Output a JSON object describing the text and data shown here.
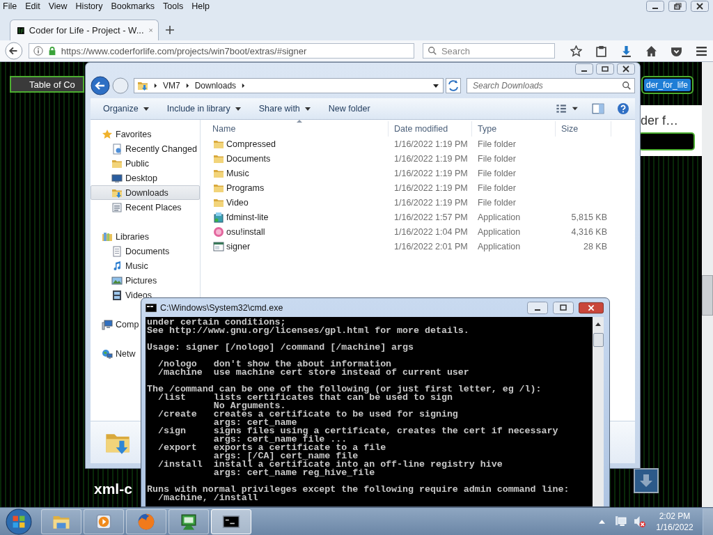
{
  "browser": {
    "menu": [
      "File",
      "Edit",
      "View",
      "History",
      "Bookmarks",
      "Tools",
      "Help"
    ],
    "tab": {
      "title": "Coder for Life - Project - W..."
    },
    "url": "https://www.coderforlife.com/projects/win7boot/extras/#signer",
    "search": {
      "placeholder": "Search"
    }
  },
  "page": {
    "toc_button": "Table of Co",
    "user_button": "der_for_life",
    "heading": "der f…",
    "footer_heading": "xml-c"
  },
  "explorer": {
    "breadcrumb": [
      "VM7",
      "Downloads"
    ],
    "search": {
      "placeholder": "Search Downloads"
    },
    "toolbar": [
      {
        "label": "Organize",
        "dropdown": true
      },
      {
        "label": "Include in library",
        "dropdown": true
      },
      {
        "label": "Share with",
        "dropdown": true
      },
      {
        "label": "New folder",
        "dropdown": false
      }
    ],
    "nav": [
      {
        "label": "Favorites",
        "kind": "star",
        "selected": false,
        "children": [
          {
            "label": "Recently Changed",
            "kind": "history",
            "selected": false
          },
          {
            "label": "Public",
            "kind": "folder",
            "selected": false
          },
          {
            "label": "Desktop",
            "kind": "desktop",
            "selected": false
          },
          {
            "label": "Downloads",
            "kind": "downloads",
            "selected": true
          },
          {
            "label": "Recent Places",
            "kind": "places",
            "selected": false
          }
        ]
      },
      {
        "label": "Libraries",
        "kind": "library",
        "selected": false,
        "children": [
          {
            "label": "Documents",
            "kind": "document",
            "selected": false
          },
          {
            "label": "Music",
            "kind": "music",
            "selected": false
          },
          {
            "label": "Pictures",
            "kind": "picture",
            "selected": false
          },
          {
            "label": "Videos",
            "kind": "video",
            "selected": false
          }
        ]
      },
      {
        "label": "Comp",
        "kind": "computer",
        "selected": false
      },
      {
        "label": "Netw",
        "kind": "network",
        "selected": false
      }
    ],
    "columns": [
      "Name",
      "Date modified",
      "Type",
      "Size"
    ],
    "files": [
      {
        "name": "Compressed",
        "date": "1/16/2022 1:19 PM",
        "type": "File folder",
        "kind": "folder"
      },
      {
        "name": "Documents",
        "date": "1/16/2022 1:19 PM",
        "type": "File folder",
        "kind": "folder"
      },
      {
        "name": "Music",
        "date": "1/16/2022 1:19 PM",
        "type": "File folder",
        "kind": "folder"
      },
      {
        "name": "Programs",
        "date": "1/16/2022 1:19 PM",
        "type": "File folder",
        "kind": "folder"
      },
      {
        "name": "Video",
        "date": "1/16/2022 1:19 PM",
        "type": "File folder",
        "kind": "folder"
      },
      {
        "name": "fdminst-lite",
        "date": "1/16/2022 1:57 PM",
        "type": "Application",
        "size": "5,815 KB",
        "kind": "installer"
      },
      {
        "name": "osu!install",
        "date": "1/16/2022 1:04 PM",
        "type": "Application",
        "size": "4,316 KB",
        "kind": "pinkapp"
      },
      {
        "name": "signer",
        "date": "1/16/2022 2:01 PM",
        "type": "Application",
        "size": "28 KB",
        "kind": "window"
      }
    ]
  },
  "cmd": {
    "title": "C:\\Windows\\System32\\cmd.exe",
    "blocks": [
      [
        "under certain conditions;",
        "See http://www.gnu.org/licenses/gpl.html for more details."
      ],
      [
        "Usage: signer [/nologo] /command [/machine] args"
      ],
      [
        "  /nologo   don't show the about information",
        "  /machine  use machine cert store instead of current user"
      ],
      [
        "The /command can be one of the following (or just first letter, eg /l):",
        "  /list     lists certificates that can be used to sign",
        "            No Arguments.",
        "  /create   creates a certificate to be used for signing",
        "            args: cert_name",
        "  /sign     signs files using a certificate, creates the cert if necessary",
        "            args: cert_name file ...",
        "  /export   exports a certificate to a file",
        "            args: [/CA] cert_name file",
        "  /install  install a certificate into an off-line registry hive",
        "            args: cert_name reg_hive_file"
      ],
      [
        "Runs with normal privileges except the following require admin command line:",
        "  /machine, /install"
      ]
    ]
  },
  "taskbar": {
    "apps": [
      {
        "kind": "explorer",
        "selected": false
      },
      {
        "kind": "media",
        "selected": false
      },
      {
        "kind": "firefox",
        "selected": false
      },
      {
        "kind": "remote",
        "selected": false
      },
      {
        "kind": "cmd",
        "selected": true
      }
    ],
    "time": "2:02 PM",
    "date": "1/16/2022"
  }
}
